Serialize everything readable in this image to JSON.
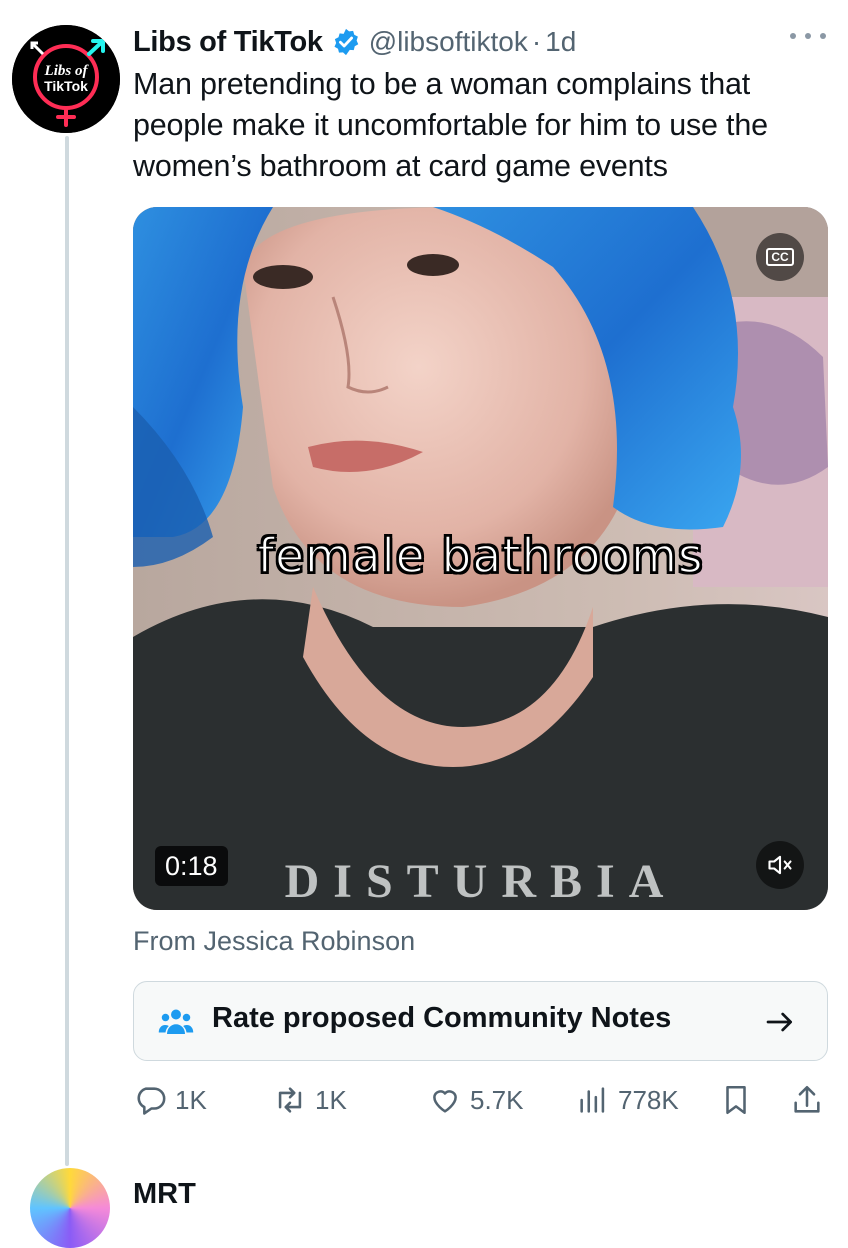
{
  "tweet": {
    "avatar": {
      "icon": "libs-of-tiktok-logo",
      "text_line1": "Libs of",
      "text_line2": "TikTok"
    },
    "display_name": "Libs of TikTok",
    "verified_icon": "verified-badge-icon",
    "handle": "@libsoftiktok",
    "separator": "·",
    "time": "1d",
    "more_icon": "more-dots-icon",
    "text": "Man pretending to be a woman complains that people make it uncomfortable for him to use the women’s bathroom at card game events",
    "media": {
      "caption": "female bathrooms",
      "cc_label": "CC",
      "duration": "0:18",
      "mute_icon": "muted-speaker-icon",
      "shirt_text": "DISTURBIA"
    },
    "source": "From Jessica Robinson",
    "community_notes": {
      "icon": "people-icon",
      "label": "Rate proposed Community Notes",
      "arrow_icon": "arrow-right-icon"
    },
    "actions": {
      "replies": "1K",
      "retweets": "1K",
      "likes": "5.7K",
      "views": "778K",
      "bookmark_icon": "bookmark-icon",
      "share_icon": "share-icon"
    }
  },
  "next_tweet": {
    "display_name": "MRT"
  },
  "colors": {
    "text": "#0f1419",
    "secondary": "#536471",
    "verified": "#1d9bf0",
    "border": "#cfd9de"
  }
}
